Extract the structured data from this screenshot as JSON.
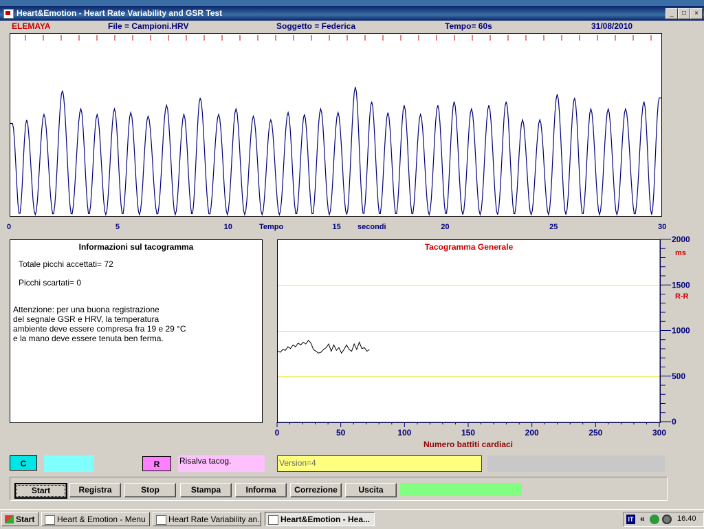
{
  "window": {
    "title": "Heart&Emotion -  Heart Rate Variability and GSR Test",
    "min": "_",
    "max": "□",
    "close": "×"
  },
  "infobar": {
    "brand": "ELEMAYA",
    "file": "File  = Campioni.HRV",
    "subject": "Soggetto = Federica",
    "time": "Tempo=  60s",
    "date": "31/08/2010"
  },
  "colors": {
    "brand": "#cc0000",
    "label": "#00007a",
    "signal": "#00007a",
    "guide": "#e6e62a",
    "cyan": "#00e5e5",
    "pink": "#ff80ff",
    "green": "#80ff80"
  },
  "signal_chart": {
    "xlabel": "Tempo",
    "xunit": "secondi",
    "ticks": [
      "0",
      "5",
      "10",
      "15",
      "20",
      "25",
      "30"
    ],
    "xlim": [
      0,
      30
    ],
    "peaks": [
      0.1,
      0.75,
      1.55,
      2.4,
      3.25,
      4.0,
      4.8,
      5.55,
      6.35,
      7.2,
      8.0,
      8.75,
      9.6,
      10.4,
      11.2,
      12.0,
      12.8,
      13.55,
      14.3,
      15.1,
      15.9,
      16.65,
      17.4,
      18.15,
      18.9,
      19.7,
      20.45,
      21.25,
      22.05,
      22.85,
      23.6,
      24.4,
      25.2,
      26.0,
      26.75,
      27.55,
      28.35,
      29.2,
      29.9
    ],
    "amps": [
      0.5,
      0.52,
      0.55,
      0.68,
      0.58,
      0.55,
      0.58,
      0.56,
      0.54,
      0.6,
      0.55,
      0.64,
      0.55,
      0.58,
      0.54,
      0.52,
      0.56,
      0.55,
      0.58,
      0.56,
      0.7,
      0.62,
      0.56,
      0.6,
      0.55,
      0.6,
      0.62,
      0.58,
      0.6,
      0.62,
      0.52,
      0.52,
      0.66,
      0.64,
      0.58,
      0.58,
      0.58,
      0.62,
      0.64
    ]
  },
  "info_panel": {
    "title": "Informazioni sul tacogramma",
    "accepted": "Totale picchi accettati= 72",
    "discarded": "Picchi scartati= 0",
    "warning": [
      "Attenzione: per una buona registrazione",
      "del segnale GSR e HRV, la temperatura",
      "ambiente deve essere compresa fra 19 e 29 °C",
      "e la mano deve essere tenuta ben ferma."
    ]
  },
  "chart_data": {
    "type": "line",
    "title": "Tacogramma Generale",
    "xlabel": "Numero battiti cardiaci",
    "ylabel": "R-R",
    "yunit": "ms",
    "xlim": [
      0,
      300
    ],
    "ylim": [
      0,
      2000
    ],
    "xticks": [
      "0",
      "50",
      "100",
      "150",
      "200",
      "250",
      "300"
    ],
    "yticks": [
      "0",
      "500",
      "1000",
      "1500",
      "2000"
    ],
    "guides": [
      500,
      1000,
      1500
    ],
    "x": [
      0,
      2,
      4,
      6,
      8,
      10,
      12,
      14,
      16,
      18,
      20,
      22,
      24,
      26,
      28,
      30,
      32,
      34,
      36,
      38,
      40,
      42,
      44,
      46,
      48,
      50,
      52,
      54,
      56,
      58,
      60,
      62,
      64,
      66,
      68,
      70,
      72
    ],
    "y": [
      780,
      770,
      800,
      790,
      830,
      810,
      850,
      830,
      870,
      850,
      880,
      860,
      900,
      870,
      800,
      780,
      760,
      770,
      800,
      820,
      860,
      780,
      850,
      790,
      820,
      760,
      800,
      850,
      800,
      780,
      860,
      800,
      880,
      810,
      820,
      780,
      800
    ]
  },
  "controls": {
    "c_button": "C",
    "r_button": "R",
    "risalva_label": "Risalva tacog.",
    "version": "Version=4"
  },
  "buttons": [
    "Start",
    "Registra",
    "Stop",
    "Stampa",
    "Informa",
    "Correzione",
    "Uscita"
  ],
  "taskbar": {
    "start": "Start",
    "tasks": [
      "Heart & Emotion - Menu",
      "Heart Rate Variability an...",
      "Heart&Emotion - Hea..."
    ],
    "lang": "IT",
    "clock": "16.40"
  }
}
